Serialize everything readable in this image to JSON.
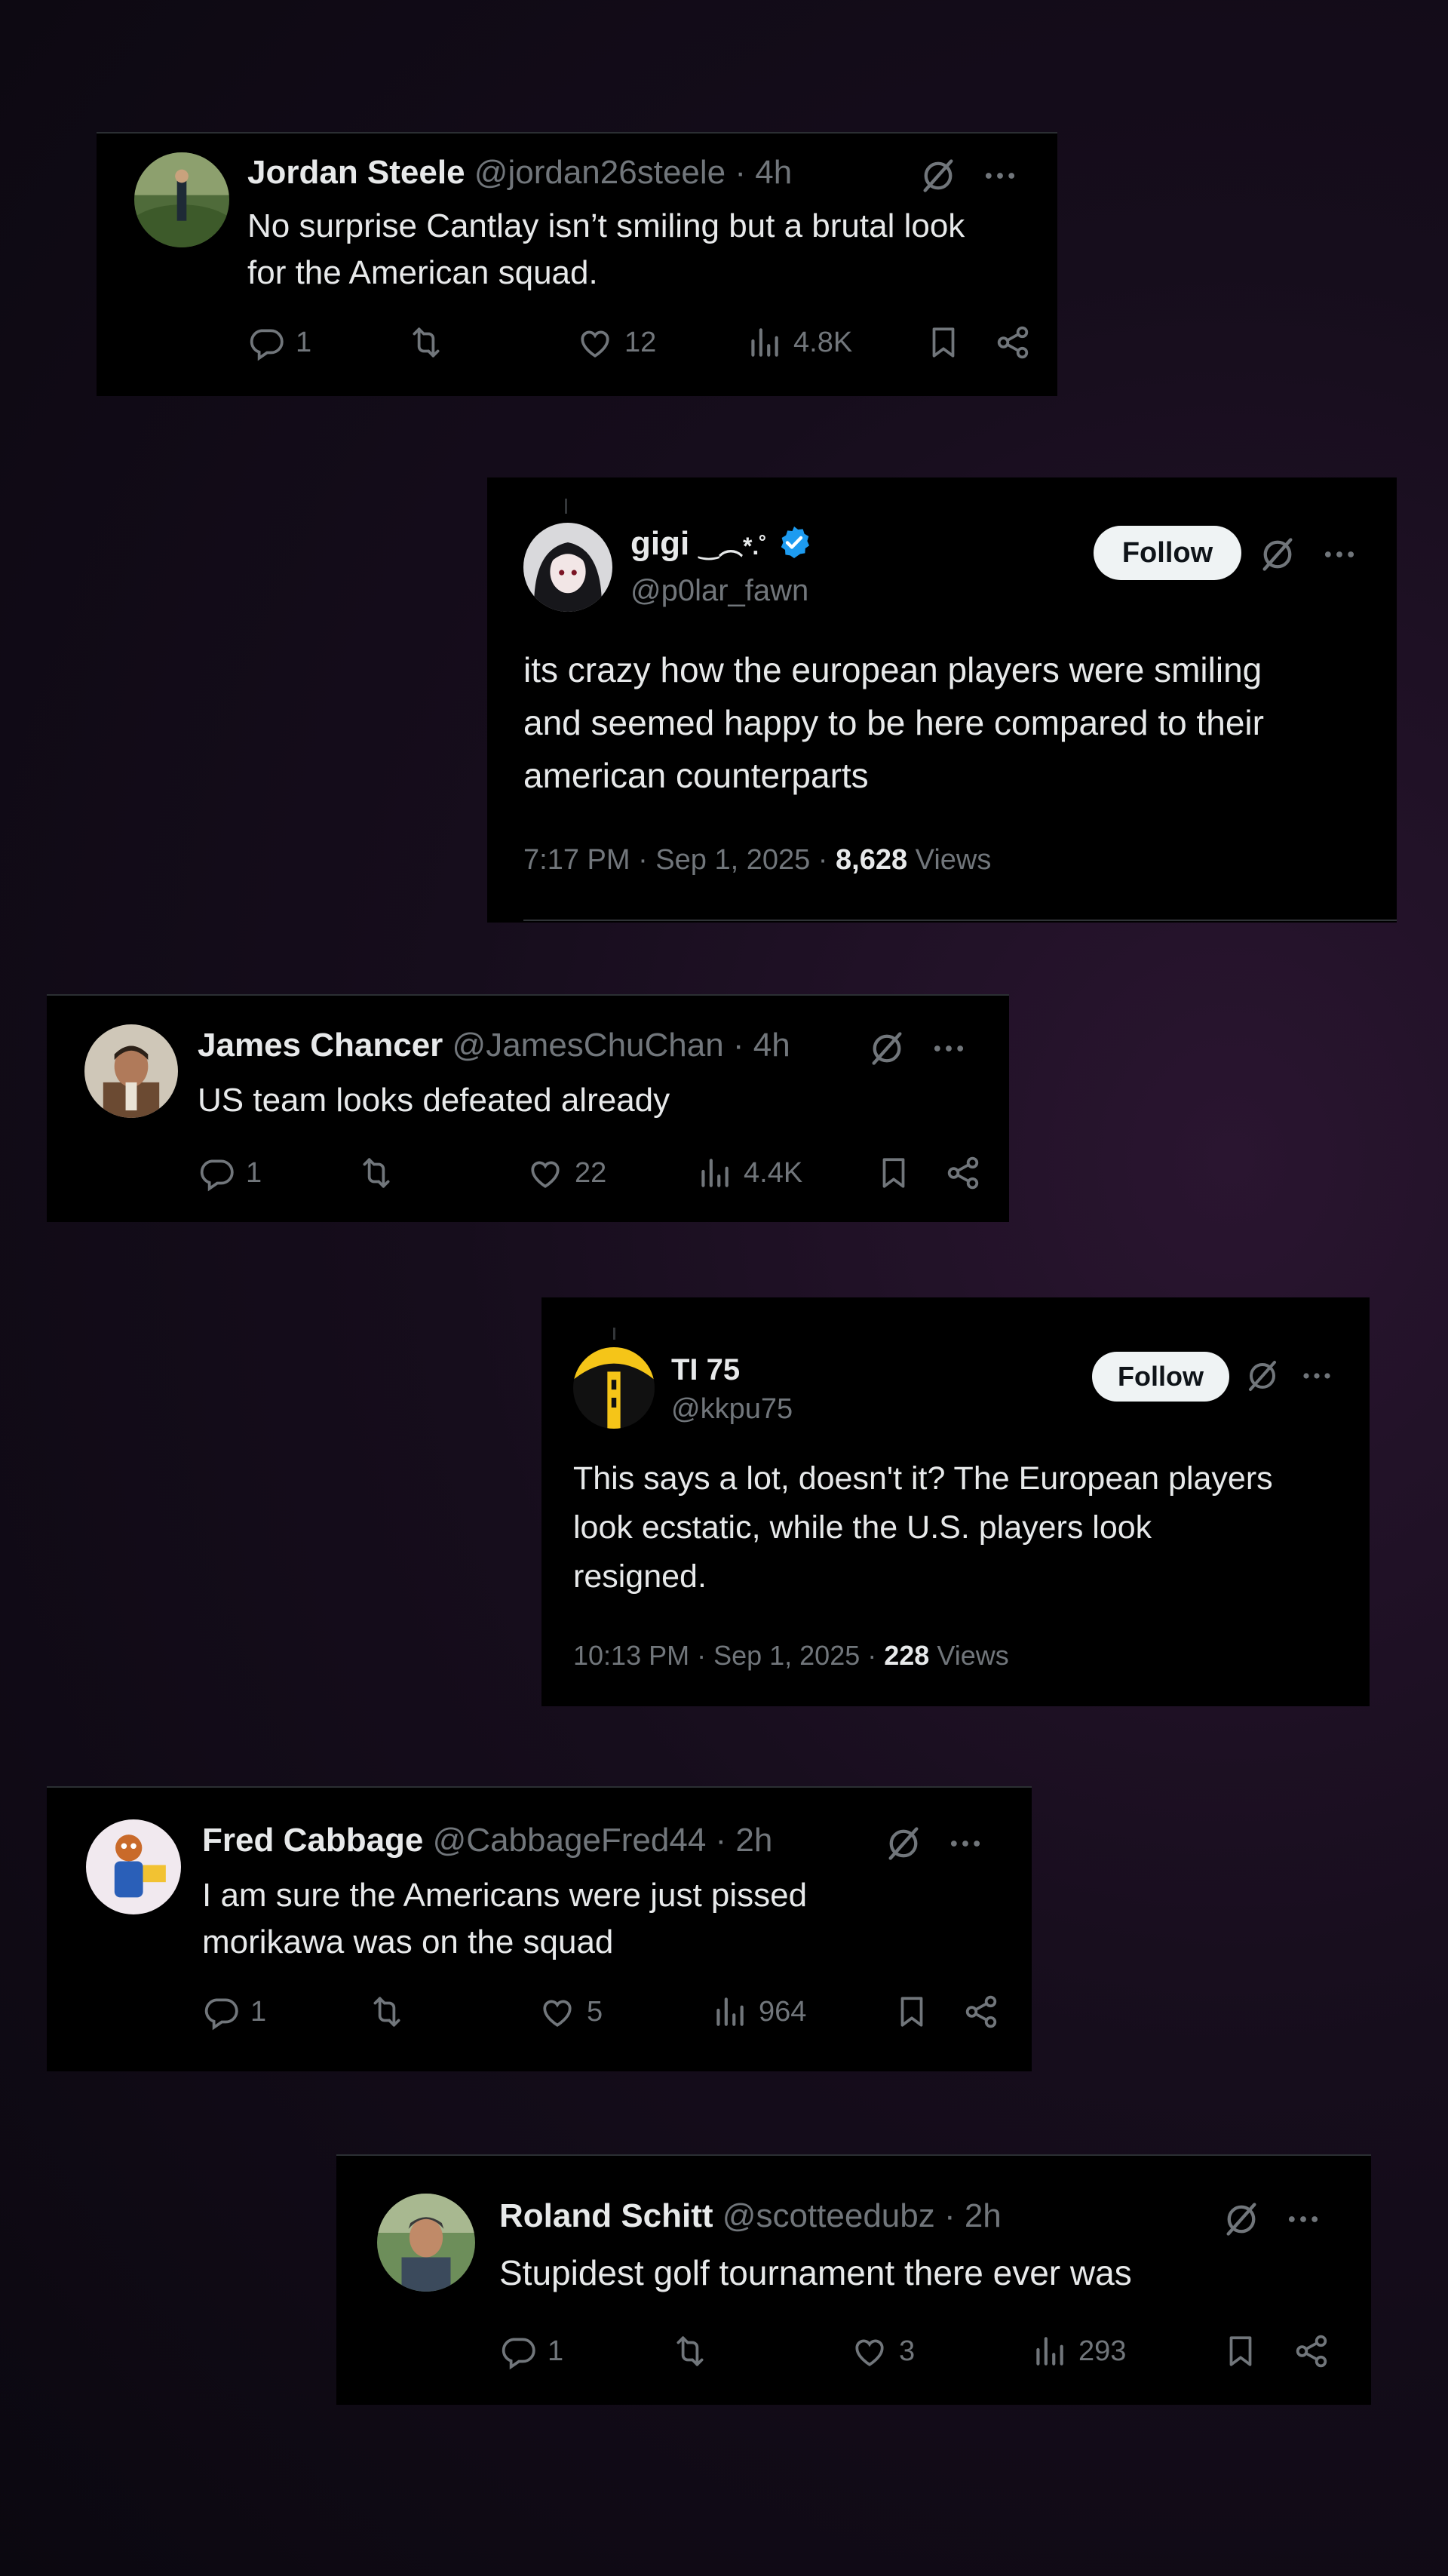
{
  "colors": {
    "background": "#160d1c",
    "card": "#000000",
    "text": "#e7e9ea",
    "secondary": "#71767b",
    "verified": "#1d9bf0",
    "follow_button": "#eff3f4"
  },
  "icons": {
    "reply": "speech-bubble-icon",
    "repost": "repost-icon",
    "like": "heart-icon",
    "views": "bar-chart-icon",
    "bookmark": "bookmark-icon",
    "share": "share-icon",
    "grok": "grok-slash-icon",
    "more": "more-dots-icon"
  },
  "posts": [
    {
      "name": "Jordan Steele",
      "handle": "@jordan26steele · 4h",
      "text_lines": [
        "No surprise Cantlay isn’t smiling but a brutal look",
        "for the American squad."
      ],
      "replies": "1",
      "likes": "12",
      "views": "4.8K"
    },
    {
      "name": "gigi",
      "name_decor": "‿︵*.˚",
      "handle": "@p0lar_fawn",
      "follow_label": "Follow",
      "text_lines": [
        "its crazy how the european players were smiling",
        "and seemed happy to be here compared to their",
        "american counterparts"
      ],
      "time": "7:17 PM · Sep 1, 2025 · ",
      "views_count": "8,628",
      "views_label": " Views"
    },
    {
      "name": "James Chancer",
      "handle": "@JamesChuChan · 4h",
      "text_lines": [
        "US team looks defeated already"
      ],
      "replies": "1",
      "likes": "22",
      "views": "4.4K"
    },
    {
      "name": "TI 75",
      "handle": "@kkpu75",
      "follow_label": "Follow",
      "text_lines": [
        "This says a lot, doesn't it? The European players",
        "look ecstatic, while the U.S. players look",
        "resigned."
      ],
      "time": "10:13 PM · Sep 1, 2025 · ",
      "views_count": "228",
      "views_label": " Views"
    },
    {
      "name": "Fred Cabbage",
      "handle": "@CabbageFred44 · 2h",
      "text_lines": [
        "I am sure the Americans were just pissed",
        "morikawa was on the squad"
      ],
      "replies": "1",
      "likes": "5",
      "views": "964"
    },
    {
      "name": "Roland Schitt",
      "handle": "@scotteedubz · 2h",
      "text_lines": [
        "Stupidest golf tournament there ever was"
      ],
      "replies": "1",
      "likes": "3",
      "views": "293"
    }
  ]
}
